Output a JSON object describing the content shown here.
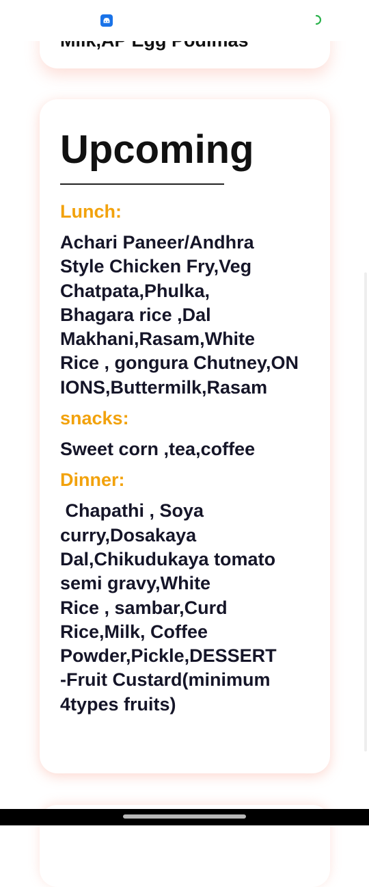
{
  "status_bar": {
    "left_icon": "app-notification-icon",
    "right_icon": "loading-spinner-icon",
    "accent": "#1a73e8",
    "spinner_color": "#2bb24c"
  },
  "previous_card": {
    "text": "Milk,AP Egg Podimas"
  },
  "upcoming": {
    "title": "Upcoming",
    "meals": [
      {
        "label": "Lunch:",
        "items": "Achari Paneer/Andhra\nStyle Chicken Fry,Veg\nChatpata,Phulka,\nBhagara rice ,Dal\nMakhani,Rasam,White\nRice , gongura Chutney,ON\nIONS,Buttermilk,Rasam"
      },
      {
        "label": "snacks:",
        "items": "Sweet corn ,tea,coffee"
      },
      {
        "label": "Dinner:",
        "items": " Chapathi , Soya\ncurry,Dosakaya\nDal,Chikudukaya tomato\nsemi gravy,White\nRice , sambar,Curd\nRice,Milk, Coffee\nPowder,Pickle,DESSERT\n-Fruit Custard(minimum\n4types fruits)"
      }
    ]
  },
  "colors": {
    "meal_label": "#f2a20c",
    "body_text": "#151528",
    "card_shadow": "#f8a08c"
  }
}
